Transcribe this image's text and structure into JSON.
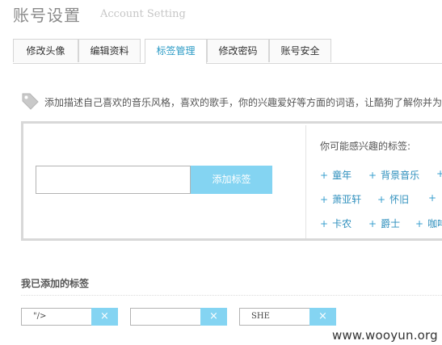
{
  "page": {
    "title": "账号设置",
    "subtitle": "Account Setting"
  },
  "tabs": [
    {
      "label": "修改头像",
      "active": false
    },
    {
      "label": "编辑资料",
      "active": false
    },
    {
      "label": "标签管理",
      "active": true
    },
    {
      "label": "修改密码",
      "active": false
    },
    {
      "label": "账号安全",
      "active": false
    }
  ],
  "description": "添加描述自己喜欢的音乐风格，喜欢的歌手，你的兴趣爱好等方面的词语，让酷狗了解你并为",
  "add_tag": {
    "input_value": "",
    "button_label": "添加标签"
  },
  "suggestions": {
    "title": "你可能感兴趣的标签:",
    "plus": "+",
    "tags": [
      "童年",
      "背景音乐",
      "萧亚轩",
      "怀旧",
      "卡农",
      "爵士",
      "咖啡"
    ]
  },
  "my_tags": {
    "title": "我已添加的标签",
    "remove_symbol": "×",
    "items": [
      "\"/>",
      "",
      "SHE"
    ]
  },
  "watermark": "www.wooyun.org",
  "colors": {
    "accent": "#84d4f2",
    "link": "#2e8fbd",
    "active_tab": "#2a9ac5",
    "border": "#d8d8d8"
  },
  "icons": {
    "description": "tag-icon",
    "remove": "close-icon"
  }
}
